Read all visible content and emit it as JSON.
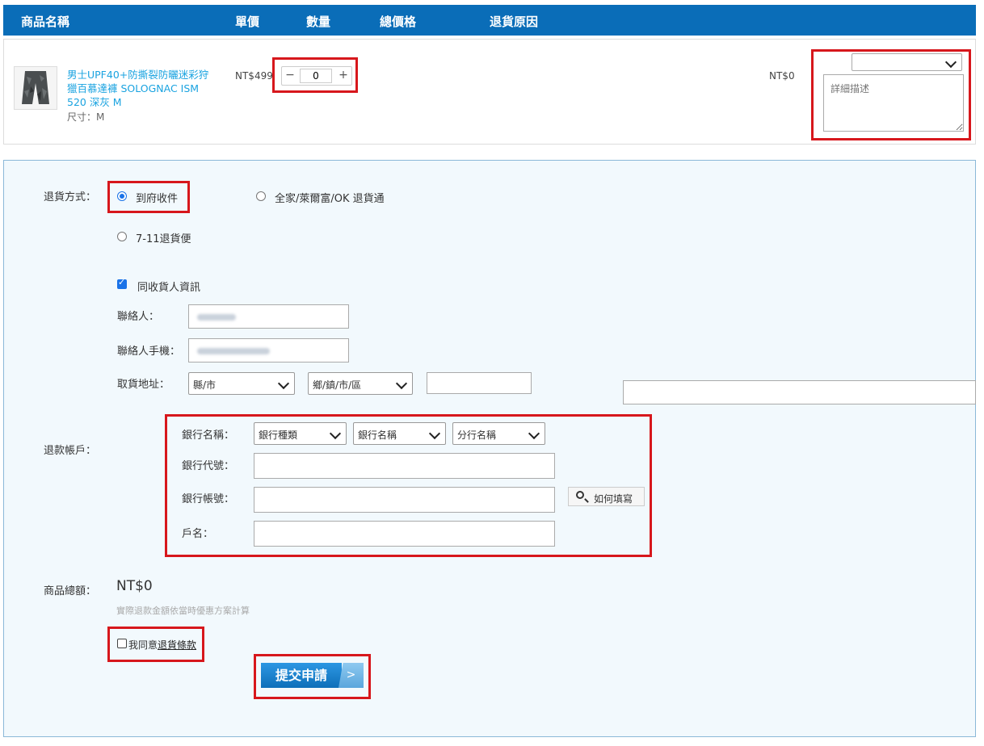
{
  "table_header": {
    "product_name": "商品名稱",
    "unit_price": "單價",
    "quantity": "數量",
    "total_price": "總價格",
    "return_reason": "退貨原因"
  },
  "product": {
    "name": "男士UPF40+防撕裂防曬迷彩狩獵百慕達褲 SOLOGNAC ISM 520 深灰 M",
    "name_lines": [
      "男士UPF40+防撕裂防曬迷彩狩",
      "獵百慕達褲 SOLOGNAC ISM",
      "520 深灰 M"
    ],
    "size": "尺寸：M",
    "price": "NT$499",
    "quantity": "0",
    "total": "NT$0",
    "reason_selected": "",
    "detail_placeholder": "詳細描述"
  },
  "return_method": {
    "label": "退貨方式：",
    "options": [
      {
        "label": "到府收件",
        "selected": true
      },
      {
        "label": "全家/萊爾富/OK 退貨通",
        "selected": false
      },
      {
        "label": "7-11退貨便",
        "selected": false
      }
    ]
  },
  "contact": {
    "same_as_recipient_label": "同收貨人資訊",
    "same_as_recipient_checked": true,
    "name_label": "聯絡人：",
    "phone_label": "聯絡人手機：",
    "address_label": "取貨地址：",
    "county_placeholder": "縣/市",
    "district_placeholder": "鄉/鎮/市/區"
  },
  "refund": {
    "label": "退款帳戶：",
    "bank_name_label": "銀行名稱：",
    "bank_type_placeholder": "銀行種類",
    "bank_name_placeholder": "銀行名稱",
    "branch_placeholder": "分行名稱",
    "bank_code_label": "銀行代號：",
    "account_label": "銀行帳號：",
    "how_to_fill": "如何填寫",
    "holder_label": "戶名："
  },
  "summary": {
    "total_label": "商品總額：",
    "total_value": "NT$0",
    "note": "實際退款金額依當時優惠方案計算"
  },
  "agreement": {
    "prefix": "我同意",
    "link_text": "退貨條款",
    "checked": false
  },
  "submit": {
    "label": "提交申請",
    "arrow": ">"
  },
  "colors": {
    "header_bg": "#0a6db8",
    "link": "#1aa3e0",
    "highlight_box": "#d7171c",
    "panel_bg": "#f2f9fd"
  }
}
